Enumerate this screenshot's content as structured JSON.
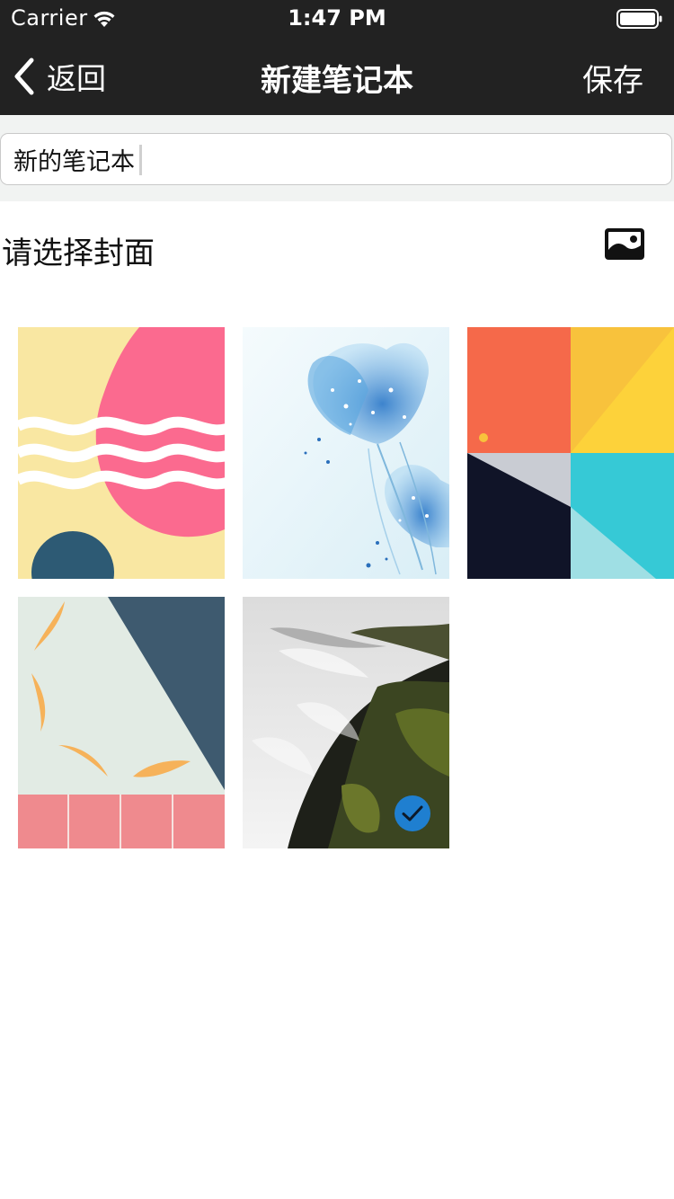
{
  "status_bar": {
    "carrier": "Carrier",
    "time": "1:47 PM"
  },
  "nav": {
    "back_label": "返回",
    "title": "新建笔记本",
    "save_label": "保存"
  },
  "notebook_name": {
    "value": "新的笔记本"
  },
  "cover_section": {
    "prompt": "请选择封面",
    "icon": "image-icon"
  },
  "covers": [
    {
      "id": "cover-waves",
      "selected": false
    },
    {
      "id": "cover-blue-flowers",
      "selected": false
    },
    {
      "id": "cover-geometric",
      "selected": false
    },
    {
      "id": "cover-leaves",
      "selected": false
    },
    {
      "id": "cover-waterfall",
      "selected": true
    }
  ],
  "colors": {
    "bar_background": "#222222",
    "input_section_background": "#f1f3f2",
    "selected_badge": "#1f7fd0"
  }
}
